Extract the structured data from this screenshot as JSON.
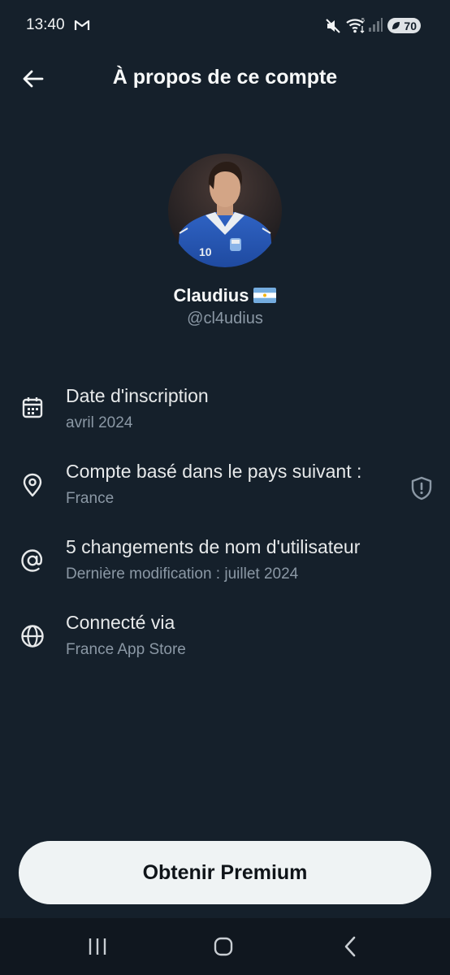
{
  "status_bar": {
    "time": "13:40",
    "battery": "70",
    "icons": [
      "gmail-icon",
      "mute-icon",
      "wifi-icon",
      "signal-icon",
      "battery-icon"
    ]
  },
  "header": {
    "title": "À propos de ce compte",
    "back_icon": "arrow-left-icon"
  },
  "profile": {
    "display_name": "Claudius",
    "flag": "argentina-flag-icon",
    "handle": "@cl4udius"
  },
  "info": {
    "items": [
      {
        "icon": "calendar-icon",
        "title": "Date d'inscription",
        "subtitle": "avril 2024"
      },
      {
        "icon": "location-pin-icon",
        "title": "Compte basé dans le pays suivant :",
        "subtitle": "France",
        "trailing_icon": "shield-icon"
      },
      {
        "icon": "at-sign-icon",
        "title": "5 changements de nom d'utilisateur",
        "subtitle": "Dernière modification : juillet 2024"
      },
      {
        "icon": "globe-icon",
        "title": "Connecté via",
        "subtitle": "France App Store"
      }
    ]
  },
  "premium": {
    "label": "Obtenir Premium"
  },
  "nav": {
    "icons": [
      "recent-apps-icon",
      "home-icon",
      "back-icon"
    ]
  },
  "colors": {
    "background": "#15202b",
    "primary_text": "#e7e9ea",
    "secondary_text": "#8b98a5",
    "button_bg": "#eff3f4",
    "button_text": "#0f1419"
  }
}
